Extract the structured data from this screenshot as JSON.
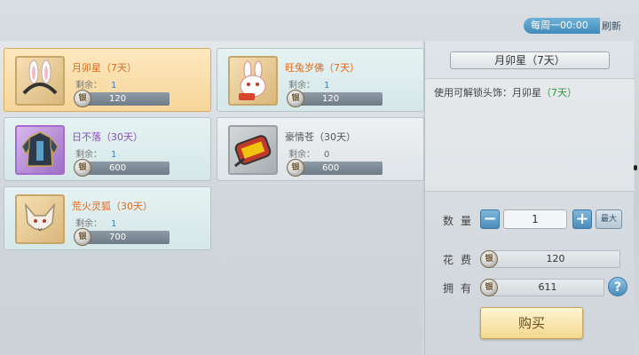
{
  "header": {
    "refresh_time": "每周一00:00",
    "refresh_label": "刷新"
  },
  "items": [
    {
      "name": "月卯星（7天）",
      "remain_label": "剩余：",
      "remain": "1",
      "price": "120",
      "icon": "rabbit-ears-headband-icon"
    },
    {
      "name": "旺兔岁佛（7天）",
      "remain_label": "剩余：",
      "remain": "1",
      "price": "120",
      "icon": "rabbit-mask-icon"
    },
    {
      "name": "日不落（30天）",
      "remain_label": "剩余：",
      "remain": "1",
      "price": "600",
      "icon": "armor-outfit-icon"
    },
    {
      "name": "豪情苍（30天）",
      "remain_label": "剩余：",
      "remain": "0",
      "price": "600",
      "icon": "lantern-weapon-icon"
    },
    {
      "name": "荒火灵狐（30天）",
      "remain_label": "剩余：",
      "remain": "1",
      "price": "700",
      "icon": "fox-mount-icon"
    }
  ],
  "currency_glyph": "银",
  "detail": {
    "title": "月卯星（7天）",
    "desc_prefix": "使用可解锁头饰：月卯星",
    "desc_duration": "（7天）",
    "quantity_label": "数量",
    "quantity": "1",
    "max_label": "最大",
    "cost_label": "花费",
    "cost": "120",
    "owned_label": "拥有",
    "owned": "611",
    "help": "?",
    "buy_label": "购买"
  },
  "colors": {
    "accent_blue": "#4c8cbc",
    "name_orange": "#e06a1e",
    "name_purple": "#8a4fc0",
    "green": "#2e9a3a"
  }
}
